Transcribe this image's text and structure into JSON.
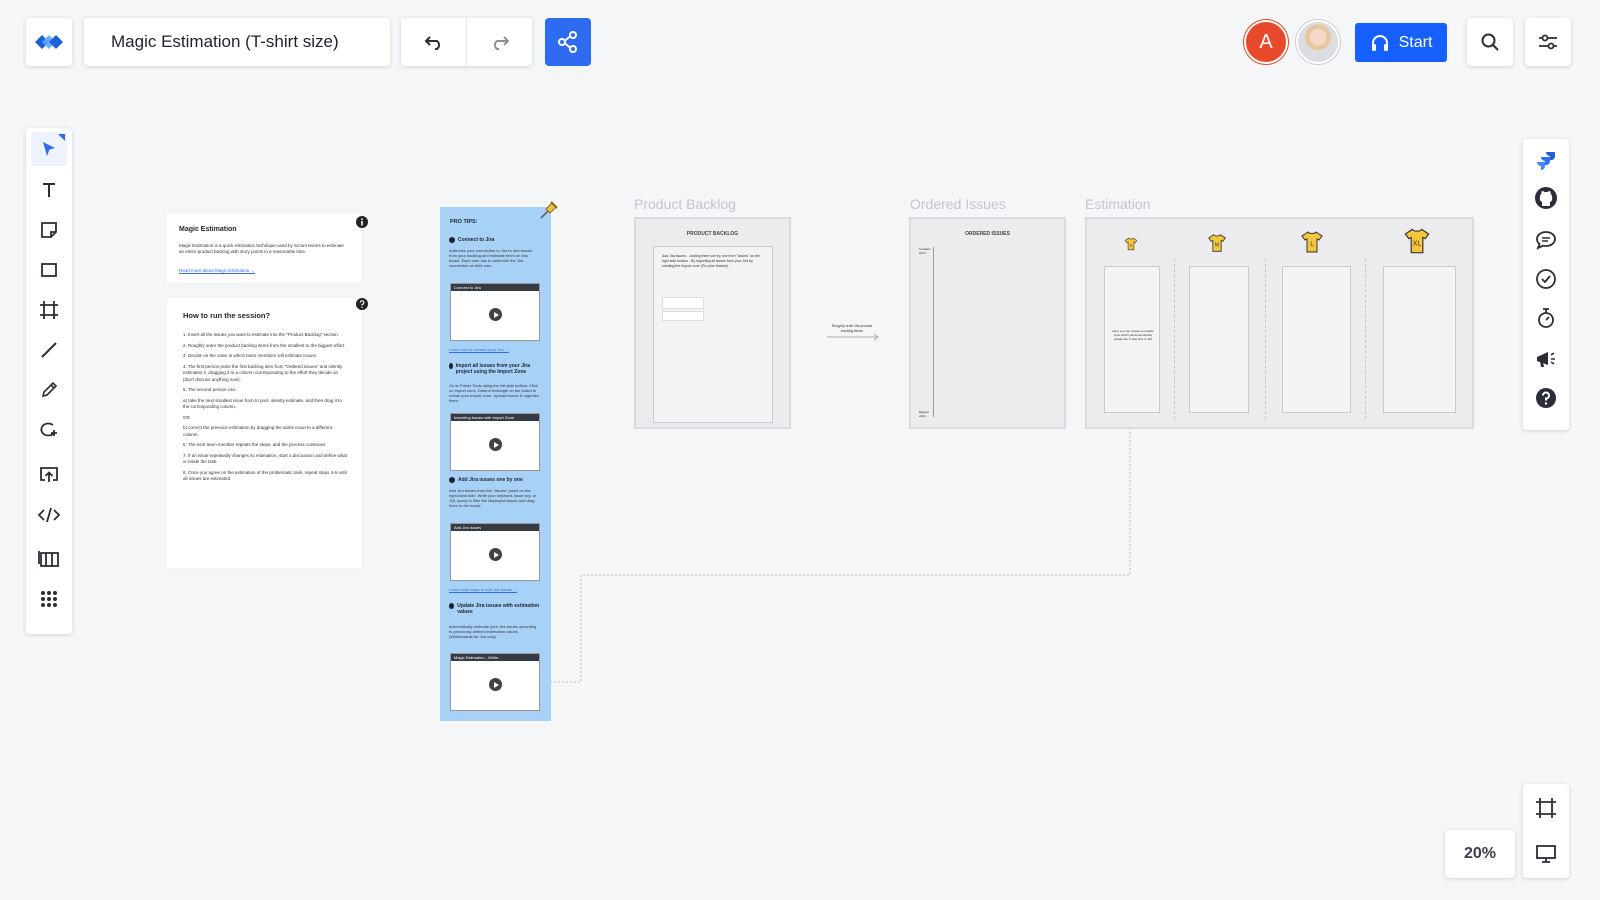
{
  "header": {
    "board_title": "Magic Estimation (T-shirt size)",
    "avatar_initial": "A",
    "start_label": "Start"
  },
  "left_toolbar": {
    "tools": [
      "select-tool",
      "text-tool",
      "sticky-note-tool",
      "shape-tool",
      "frame-tool",
      "line-tool",
      "pen-tool",
      "lasso-tool",
      "upload-tool",
      "embed-tool",
      "templates-tool",
      "more-apps-tool"
    ]
  },
  "right_toolbar": {
    "items": [
      "jira-icon",
      "github-icon",
      "comments-icon",
      "check-icon",
      "timer-icon",
      "announcement-icon",
      "help-icon"
    ]
  },
  "zoom": {
    "level": "20%"
  },
  "canvas": {
    "intro_card": {
      "title": "Magic Estimation",
      "text": "Magic Estimation is a quick estimation technique used by Scrum teams to estimate an entire product backlog with story points in a reasonable time.",
      "link": "Read more about Magic Estimation →"
    },
    "howto_card": {
      "title": "How to run the session?",
      "steps": [
        "1. Insert all the issues you want to estimate into the \"Product Backlog\" section.",
        "2. Roughly order the product backlog items from the smallest to the biggest effort.",
        "3. Decide on the order in which team members will estimate issues.",
        "4. The first person picks the first backlog item from \"Ordered issues\" and silently estimates it, dragging it to a column corresponding to the effort they decide on (don't discuss anything now).",
        "5. The second person can:",
        "a) take the next smallest issue from to pool, silently estimate, and then drag it to the corresponding column,",
        "OR",
        "b) correct the previous estimation by dragging the same issue to a different column.",
        "6. The next team member repeats the steps, and the process continues.",
        "7. If an issue repeatedly changes its estimation, start a discussion and define what is inside the task.",
        "8. Once you agree on the estimation of the problematic task, repeat steps 4-6 until all issues are estimated."
      ]
    },
    "pro_tips": {
      "title": "PRO TIPS:",
      "tips": [
        {
          "title": "Connect to Jira",
          "text": "Authorize your connection to Jira to add issues from your backlog and estimate them on this board. Each user has to authorize the Jira connection on their own.",
          "thumb": "Connect to Jira",
          "link": "Learn how to connect your Jira →"
        },
        {
          "title": "Import all issues from your Jira project using the Import Zone",
          "text": "Go to Power Tools using the left side toolbar. Click on Import zone. Draw a rectangle on the board to create your Import zone. Upload issues & organize them.",
          "thumb": "Importing issues with Import Zone",
          "link": ""
        },
        {
          "title": "Add Jira issues one by one",
          "text": "Add Jira issues from the \"Issues\" panel on the right-hand side. Write your keyword, issue key, or JQL query to filter the displayed issues and drag them to the board.",
          "thumb": "Add Jira issues",
          "link": "Learn more ways to add Jira issues →"
        },
        {
          "title": "Update Jira issues with estimation values",
          "text": "Automatically estimate your Jira issues according to previously defined estimation values (Whiteboards for Jira only).",
          "thumb": "Magic Estimation - White...",
          "link": ""
        }
      ]
    },
    "product_backlog": {
      "label": "Product Backlog",
      "header": "PRODUCT BACKLOG",
      "text": "Add Jira issues: - Adding them one by one from \"Issues\" on the right side toolbar - By importing all issues from your Jira by creating the Import zone (Pro plan feature)."
    },
    "arrow_note": "Roughly order the product backlog items",
    "ordered_issues": {
      "label": "Ordered Issues",
      "header": "ORDERED ISSUES",
      "top_label": "Smallest effort",
      "bottom_label": "Biggest effort"
    },
    "estimation": {
      "label": "Estimation",
      "sizes": [
        "S",
        "M",
        "L",
        "XL"
      ],
      "col_note": "Here you can create an update zone which will automatically update the T-shirt size in Jira"
    }
  }
}
